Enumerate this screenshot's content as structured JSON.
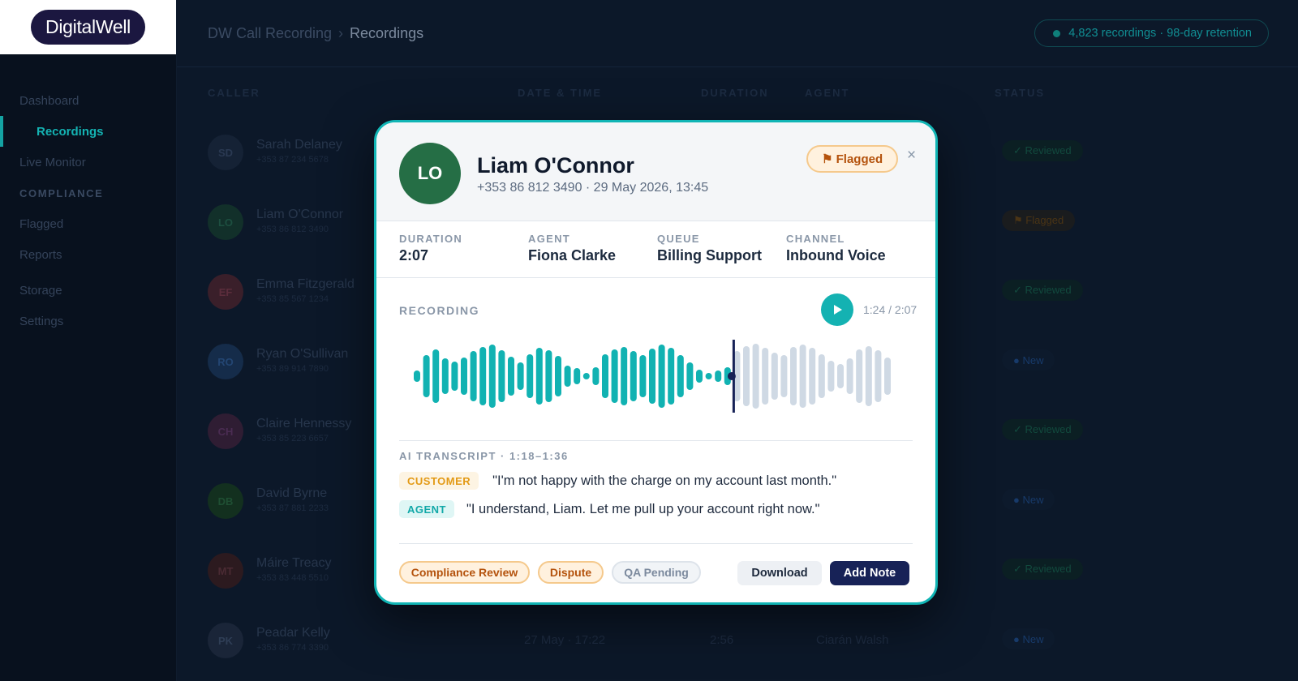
{
  "brand": {
    "logo_text": "DigitalWell"
  },
  "sidebar": {
    "items": [
      {
        "label": "Dashboard"
      },
      {
        "label": "Recordings"
      },
      {
        "label": "Live Monitor"
      },
      {
        "section": "COMPLIANCE"
      },
      {
        "label": "Flagged"
      },
      {
        "label": "Reports"
      },
      {
        "label": "Storage"
      },
      {
        "label": "Settings"
      }
    ]
  },
  "header": {
    "breadcrumb": [
      "DW Call Recording",
      "Recordings"
    ],
    "breadcrumb_separator": "›",
    "stats": "4,823 recordings · 98-day retention"
  },
  "table": {
    "columns": [
      "CALLER",
      "DATE & TIME",
      "DURATION",
      "AGENT",
      "STATUS"
    ],
    "rows": [
      {
        "initials": "SD",
        "name": "Sarah Delaney",
        "phone": "+353 87 234 5678",
        "datetime": "",
        "duration": "",
        "agent": "",
        "status": "✓ Reviewed",
        "status_kind": "reviewed",
        "avatar_bg": "#152235",
        "avatar_fg": "#2a3952"
      },
      {
        "initials": "LO",
        "name": "Liam O'Connor",
        "phone": "+353 86 812 3490",
        "datetime": "",
        "duration": "",
        "agent": "",
        "status": "⚑ Flagged",
        "status_kind": "flagged",
        "avatar_bg": "#12302a",
        "avatar_fg": "#1d4f40"
      },
      {
        "initials": "EF",
        "name": "Emma Fitzgerald",
        "phone": "+353 85 567 1234",
        "datetime": "",
        "duration": "",
        "agent": "",
        "status": "✓ Reviewed",
        "status_kind": "reviewed",
        "avatar_bg": "#3a1f2a",
        "avatar_fg": "#5c2d3c"
      },
      {
        "initials": "RO",
        "name": "Ryan O'Sullivan",
        "phone": "+353 89 914 7890",
        "datetime": "",
        "duration": "",
        "agent": "",
        "status": "● New",
        "status_kind": "new",
        "avatar_bg": "#152c4a",
        "avatar_fg": "#234673"
      },
      {
        "initials": "CH",
        "name": "Claire Hennessy",
        "phone": "+353 85 223 6657",
        "datetime": "",
        "duration": "",
        "agent": "",
        "status": "✓ Reviewed",
        "status_kind": "reviewed",
        "avatar_bg": "#2f1d33",
        "avatar_fg": "#4a2c52"
      },
      {
        "initials": "DB",
        "name": "David Byrne",
        "phone": "+353 87 881 2233",
        "datetime": "",
        "duration": "",
        "agent": "",
        "status": "● New",
        "status_kind": "new",
        "avatar_bg": "#13301f",
        "avatar_fg": "#1f4f33"
      },
      {
        "initials": "MT",
        "name": "Máire Treacy",
        "phone": "+353 83 448 5510",
        "datetime": "",
        "duration": "",
        "agent": "",
        "status": "✓ Reviewed",
        "status_kind": "reviewed",
        "avatar_bg": "#2c1a1f",
        "avatar_fg": "#4a2a33"
      },
      {
        "initials": "PK",
        "name": "Peadar Kelly",
        "phone": "+353 86 774 3390",
        "datetime": "27 May · 17:22",
        "duration": "2:56",
        "agent": "Ciarán Walsh",
        "status": "● New",
        "status_kind": "new",
        "avatar_bg": "#1a2538",
        "avatar_fg": "#2f3e56"
      }
    ]
  },
  "modal": {
    "initials": "LO",
    "name": "Liam O'Connor",
    "subtitle": "+353 86 812 3490 · 29 May 2026, 13:45",
    "flag_label": "⚑ Flagged",
    "close_label": "×",
    "meta": [
      {
        "label": "DURATION",
        "value": "2:07"
      },
      {
        "label": "AGENT",
        "value": "Fiona Clarke"
      },
      {
        "label": "QUEUE",
        "value": "Billing Support"
      },
      {
        "label": "CHANNEL",
        "value": "Inbound Voice"
      }
    ],
    "recording_label": "RECORDING",
    "time": "1:24 / 2:07",
    "progress_fraction": 0.66,
    "transcript_label": "AI TRANSCRIPT · 1:18–1:36",
    "transcript": [
      {
        "speaker": "CUSTOMER",
        "text": "\"I'm not happy with the charge on my account last month.\""
      },
      {
        "speaker": "AGENT",
        "text": "\"I understand, Liam. Let me pull up your account right now.\""
      }
    ],
    "tags": [
      "Compliance Review",
      "Dispute",
      "QA Pending"
    ],
    "actions": {
      "download": "Download",
      "add_note": "Add Note"
    }
  },
  "colors": {
    "accent": "#14b2b2",
    "flag": "#b4520c",
    "navy": "#172257",
    "avatar_modal": "#256e45"
  }
}
